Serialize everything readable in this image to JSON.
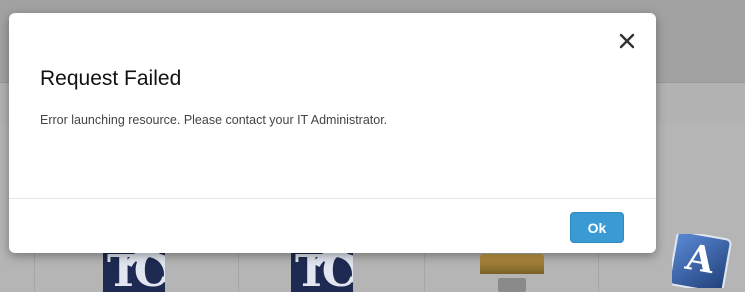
{
  "dialog": {
    "title": "Request Failed",
    "message": "Error launching resource. Please contact your IT Administrator.",
    "ok_label": "Ok",
    "close_icon": "close-icon"
  },
  "background": {
    "tiles": [
      {
        "icon": "tc-app-icon"
      },
      {
        "icon": "tc-app-icon"
      },
      {
        "icon": "monitor-icon"
      },
      {
        "icon": "app-store-icon"
      }
    ]
  },
  "colors": {
    "primary_button": "#3a9bd4",
    "overlay": "#a3a3a3",
    "dialog_bg": "#ffffff"
  }
}
